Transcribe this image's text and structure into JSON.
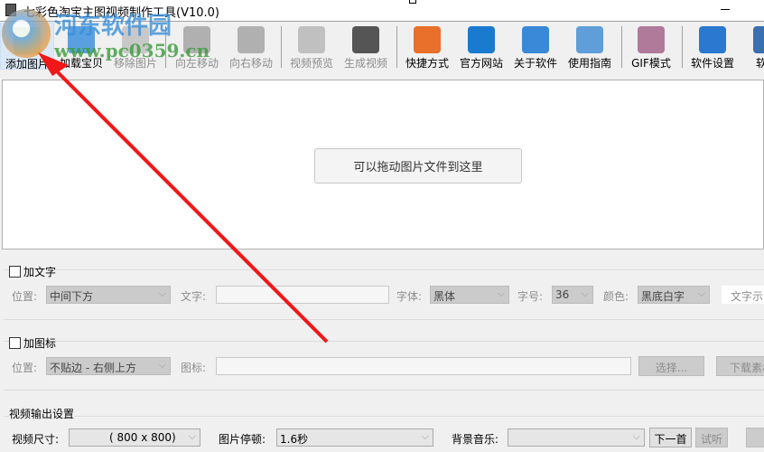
{
  "title": "七彩色淘宝主图视频制作工具(V10.0)",
  "watermark": {
    "name": "河东软件园",
    "url": "www.pc0359.cn"
  },
  "toolbar": [
    {
      "label": "添加图片",
      "icon": "add-image-icon",
      "enabled": true
    },
    {
      "label": "加载宝贝",
      "icon": "load-product-icon",
      "enabled": true
    },
    {
      "label": "移除图片",
      "icon": "remove-image-icon",
      "enabled": false
    },
    {
      "label": "向左移动",
      "icon": "arrow-left-icon",
      "enabled": false
    },
    {
      "label": "向右移动",
      "icon": "arrow-right-icon",
      "enabled": false
    },
    {
      "label": "视频预览",
      "icon": "magnifier-icon",
      "enabled": false
    },
    {
      "label": "生成视频",
      "icon": "clapperboard-icon",
      "enabled": false
    },
    {
      "label": "快捷方式",
      "icon": "cubes-icon",
      "enabled": true
    },
    {
      "label": "官方网站",
      "icon": "browser-icon",
      "enabled": true
    },
    {
      "label": "关于软件",
      "icon": "info-icon",
      "enabled": true
    },
    {
      "label": "使用指南",
      "icon": "guide-icon",
      "enabled": true
    },
    {
      "label": "GIF模式",
      "icon": "film-icon",
      "enabled": true
    },
    {
      "label": "软件设置",
      "icon": "gear-icon",
      "enabled": true
    },
    {
      "label": "软件",
      "icon": "monitor-icon",
      "enabled": true
    }
  ],
  "drop_hint": "可以拖动图片文件到这里",
  "text_group": {
    "legend": "加文字",
    "position_label": "位置:",
    "position_value": "中间下方",
    "text_label": "文字:",
    "text_value": "",
    "font_label": "字体:",
    "font_value": "黑体",
    "size_label": "字号:",
    "size_value": "36",
    "color_label": "颜色:",
    "color_value": "黑底白字",
    "preview_label": "文字示"
  },
  "icon_group": {
    "legend": "加图标",
    "position_label": "位置:",
    "position_value": "不贴边 - 右侧上方",
    "icon_label": "图标:",
    "icon_value": "",
    "choose_button": "选择...",
    "download_button": "下载素材"
  },
  "output": {
    "legend": "视频输出设置",
    "size_label": "视频尺寸:",
    "size_value": "( 800 x  800)",
    "pause_label": "图片停顿:",
    "pause_value": "1.6秒",
    "music_label": "背景音乐:",
    "music_value": "",
    "next_button": "下一首",
    "listen_button": "试听"
  }
}
